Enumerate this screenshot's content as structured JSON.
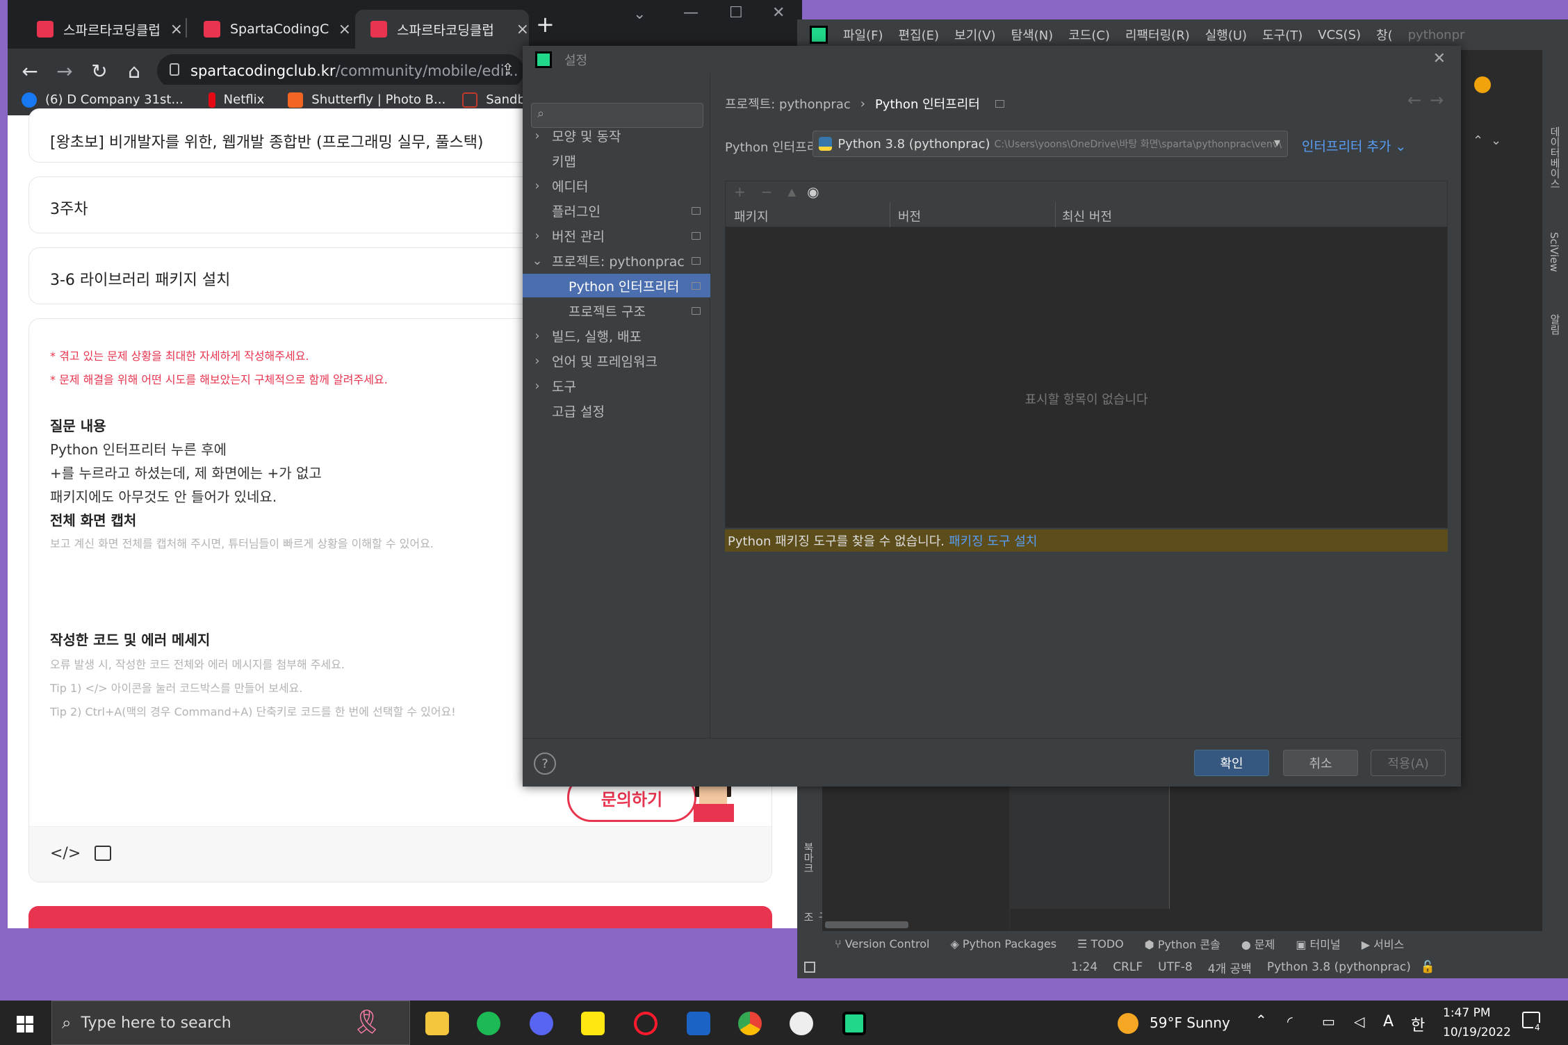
{
  "chrome": {
    "tabs": [
      {
        "title": "스파르타코딩클럽",
        "icon": "sparta-heart-icon",
        "close": "×"
      },
      {
        "title": "SpartaCodingClub",
        "icon": "sparta-logo-icon",
        "close": "×"
      },
      {
        "title": "스파르타코딩클럽",
        "icon": "sparta-heart-icon",
        "close": "×"
      }
    ],
    "new_tab": "+",
    "window_controls": {
      "dropdown": "⌄",
      "minimize": "—",
      "maximize": "☐",
      "close": "✕"
    },
    "url": {
      "domain": "spartacodingclub.kr",
      "path": "/community/mobile/edi..."
    },
    "bookmarks": [
      {
        "label": "(6) D Company 31st...",
        "icon": "facebook-icon",
        "color": "#1877f2"
      },
      {
        "label": "Netflix",
        "icon": "netflix-icon",
        "color": "#e50914"
      },
      {
        "label": "Shutterfly | Photo B...",
        "icon": "shutterfly-icon",
        "color": "#f26522"
      },
      {
        "label": "Sandboxx - Le",
        "icon": "sandboxx-icon",
        "color": "#c0392b"
      }
    ]
  },
  "page": {
    "course_title": "[왕초보] 비개발자를 위한, 웹개발 종합반 (프로그래밍 실무, 풀스택)",
    "week": "3주차",
    "lesson": "3-6 라이브러리 패키지 설치",
    "hints": [
      "* 겪고 있는 문제 상황을 최대한 자세하게 작성해주세요.",
      "* 문제 해결을 위해 어떤 시도를 해보았는지 구체적으로 함께 알려주세요."
    ],
    "question_heading": "질문 내용",
    "question_lines": [
      "Python 인터프리터 누른 후에",
      "+를 누르라고 하셨는데, 제 화면에는 +가 없고",
      "패키지에도 아무것도 안 들어가 있네요."
    ],
    "capture_heading": "전체 화면 캡처",
    "capture_hint": "보고 계신 화면 전체를 캡처해 주시면, 튜터님들이 빠르게 상황을 이해할 수 있어요.",
    "code_heading": "작성한 코드 및 에러 메세지",
    "code_hints": [
      "오류 발생 시, 작성한 코드 전체와 에러 메시지를 첨부해 주세요.",
      "Tip 1) </> 아이콘을 눌러 코드박스를 만들어 보세요.",
      "Tip 2) Ctrl+A(맥의 경우 Command+A) 단축키로 코드를 한 번에 선택할 수 있어요!"
    ],
    "ask_button": "문의하기",
    "toolbar_code": "</>",
    "accent": "#e8344e"
  },
  "pycharm": {
    "menu": [
      "파일(F)",
      "편집(E)",
      "보기(V)",
      "탐색(N)",
      "코드(C)",
      "리팩터링(R)",
      "실행(U)",
      "도구(T)",
      "VCS(S)",
      "창("
    ],
    "project_label": "pythonpr",
    "warnings": "⚠1",
    "right_stripe": [
      "데이터베이스",
      "SciView",
      "알림"
    ],
    "left_stripe": [
      "북마크",
      "구조"
    ],
    "bottom_tools": [
      {
        "label": "Version Control",
        "icon": "branch-icon"
      },
      {
        "label": "Python Packages",
        "icon": "layers-icon"
      },
      {
        "label": "TODO",
        "icon": "list-icon"
      },
      {
        "label": "Python 콘솔",
        "icon": "python-icon"
      },
      {
        "label": "문제",
        "icon": "info-icon"
      },
      {
        "label": "터미널",
        "icon": "terminal-icon"
      },
      {
        "label": "서비스",
        "icon": "play-icon"
      }
    ],
    "status": {
      "position": "1:24",
      "line_sep": "CRLF",
      "encoding": "UTF-8",
      "indent": "4개 공백",
      "interpreter": "Python 3.8 (pythonprac)"
    }
  },
  "settings": {
    "title": "설정",
    "close": "✕",
    "search_placeholder": "",
    "tree": [
      {
        "label": "모양 및 동작",
        "arrow": "›",
        "icon": false,
        "selected": false,
        "indent": 0
      },
      {
        "label": "키맵",
        "arrow": "",
        "icon": false,
        "selected": false,
        "indent": 0
      },
      {
        "label": "에디터",
        "arrow": "›",
        "icon": false,
        "selected": false,
        "indent": 0
      },
      {
        "label": "플러그인",
        "arrow": "",
        "icon": true,
        "selected": false,
        "indent": 0
      },
      {
        "label": "버전 관리",
        "arrow": "›",
        "icon": true,
        "selected": false,
        "indent": 0
      },
      {
        "label": "프로젝트: pythonprac",
        "arrow": "⌄",
        "icon": true,
        "selected": false,
        "indent": 0
      },
      {
        "label": "Python 인터프리터",
        "arrow": "",
        "icon": true,
        "selected": true,
        "indent": 1
      },
      {
        "label": "프로젝트 구조",
        "arrow": "",
        "icon": true,
        "selected": false,
        "indent": 1
      },
      {
        "label": "빌드, 실행, 배포",
        "arrow": "›",
        "icon": false,
        "selected": false,
        "indent": 0
      },
      {
        "label": "언어 및 프레임워크",
        "arrow": "›",
        "icon": false,
        "selected": false,
        "indent": 0
      },
      {
        "label": "도구",
        "arrow": "›",
        "icon": false,
        "selected": false,
        "indent": 0
      },
      {
        "label": "고급 설정",
        "arrow": "",
        "icon": false,
        "selected": false,
        "indent": 0
      }
    ],
    "breadcrumb": {
      "project": "프로젝트: pythonprac",
      "sep": "›",
      "page": "Python 인터프리터"
    },
    "interpreter_label": "Python 인터프리터:",
    "interpreter_value": "Python 3.8 (pythonprac)",
    "interpreter_path": "C:\\Users\\yoons\\OneDrive\\바탕 화면\\sparta\\pythonprac\\venv\\",
    "add_interpreter": "인터프리터 추가",
    "table_tools": [
      "+",
      "−",
      "▲",
      "👁"
    ],
    "columns": [
      "패키지",
      "버전",
      "최신 버전"
    ],
    "empty_text": "표시할 항목이 없습니다",
    "warning_text": "Python 패키징 도구를 찾을 수 없습니다.",
    "warning_link": "패키징 도구 설치",
    "help": "?",
    "buttons": {
      "ok": "확인",
      "cancel": "취소",
      "apply": "적용(A)"
    }
  },
  "taskbar": {
    "search_placeholder": "Type here to search",
    "weather": "59°F  Sunny",
    "time": "1:47 PM",
    "date": "10/19/2022",
    "ime": "A",
    "lang": "한",
    "notifications": "4"
  }
}
